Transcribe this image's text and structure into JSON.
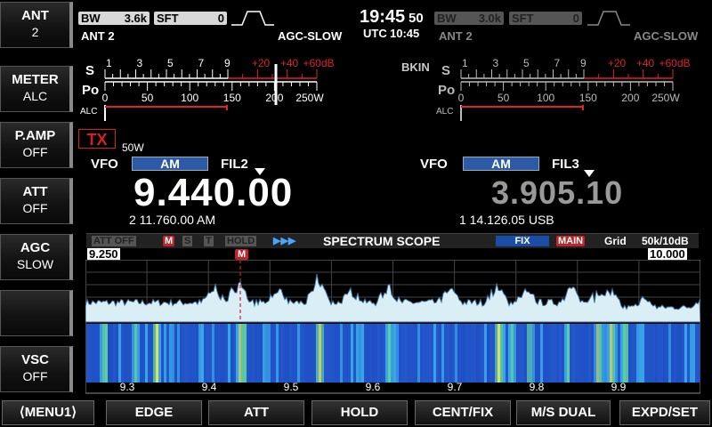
{
  "left_keys": [
    {
      "title": "ANT",
      "value": "2"
    },
    {
      "title": "METER",
      "value": "ALC"
    },
    {
      "title": "P.AMP",
      "value": "OFF"
    },
    {
      "title": "ATT",
      "value": "OFF"
    },
    {
      "title": "AGC",
      "value": "SLOW"
    },
    {
      "title": "",
      "value": ""
    },
    {
      "title": "VSC",
      "value": "OFF"
    }
  ],
  "bottom_keys": [
    "⟨MENU1⟩",
    "EDGE",
    "ATT",
    "HOLD",
    "CENT/FIX",
    "M/S DUAL",
    "EXPD/SET"
  ],
  "main": {
    "bw_label": "BW",
    "bw_value": "3.6k",
    "sft_label": "SFT",
    "sft_value": "0",
    "ant": "ANT 2",
    "agc": "AGC-SLOW",
    "vfo": "VFO",
    "mode": "AM",
    "fil": "FIL2",
    "freq": "9.440.00",
    "tx": "TX",
    "power": "50W",
    "sub_line": "2  11.760.00  AM",
    "meter_s_label": "S",
    "meter_po_label": "Po",
    "meter_alc_label": "ALC",
    "s_ticks": [
      "1",
      "3",
      "5",
      "7",
      "9",
      "+20",
      "+40",
      "+60dB"
    ],
    "po_ticks": [
      "0",
      "50",
      "100",
      "150",
      "200",
      "250W"
    ]
  },
  "sub": {
    "bw_label": "BW",
    "bw_value": "3.0k",
    "sft_label": "SFT",
    "sft_value": "0",
    "ant": "ANT 2",
    "agc": "AGC-SLOW",
    "bkin": "BKIN",
    "vfo": "VFO",
    "mode": "AM",
    "fil": "FIL3",
    "freq": "3.905.10",
    "sub_line": "1  14.126.05  USB",
    "meter_s_label": "S",
    "meter_po_label": "Po",
    "meter_alc_label": "ALC",
    "s_ticks": [
      "1",
      "3",
      "5",
      "7",
      "9",
      "+20",
      "+40",
      "+60dB"
    ],
    "po_ticks": [
      "0",
      "50",
      "100",
      "150",
      "200",
      "250W"
    ]
  },
  "clock": {
    "time": "19:45",
    "seconds": "50",
    "utc_label": "UTC",
    "utc_time": "10:45"
  },
  "scope": {
    "att_off": "ATT OFF",
    "m": "M",
    "s": "S",
    "t": "T",
    "hold": "HOLD",
    "arrows": "▶▶▶",
    "title": "SPECTRUM  SCOPE",
    "fix": "FIX",
    "main_tag": "MAIN",
    "grid": "Grid",
    "span": "50k/10dB",
    "left_freq": "9.250",
    "right_freq": "10.000",
    "marker": "M",
    "axis": [
      "9.3",
      "9.4",
      "9.5",
      "9.6",
      "9.7",
      "9.8",
      "9.9"
    ]
  },
  "colors": {
    "accent_blue": "#2c5aa6",
    "tx_red": "#d32027",
    "scale_red": "#e0202a",
    "water_blue": "#1e5bd8"
  }
}
